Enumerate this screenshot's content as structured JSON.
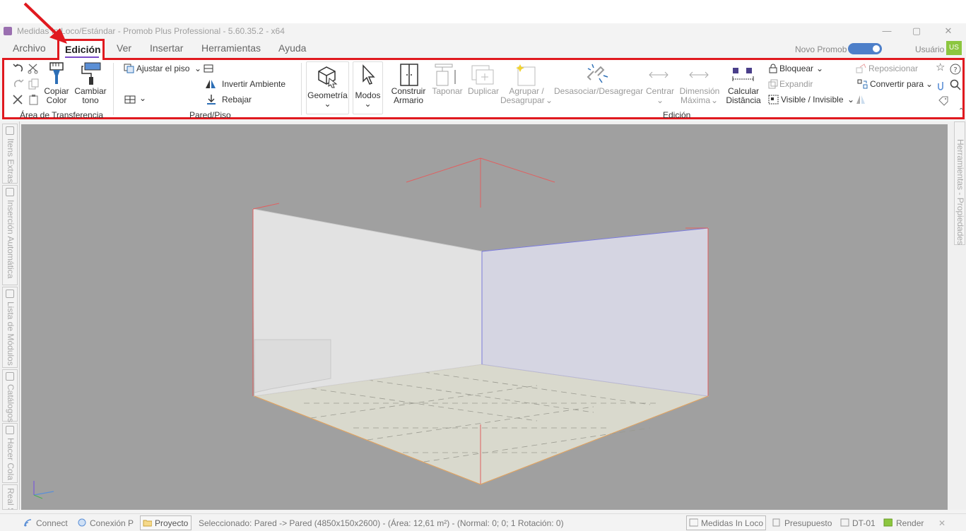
{
  "window": {
    "title": "Medidas In Loco/Estándar - Promob Plus Professional - 5.60.35.2 - x64",
    "minimize": "—",
    "maximize": "▢",
    "close": "✕"
  },
  "menu": {
    "archivo": "Archivo",
    "edicion": "Edición",
    "ver": "Ver",
    "insertar": "Insertar",
    "herramientas": "Herramientas",
    "ayuda": "Ayuda",
    "novo_promob": "Novo Promob",
    "usuario": "Usuário",
    "user_initials": "US"
  },
  "ribbon": {
    "transfer": {
      "copiar_color": [
        "Copiar",
        "Color"
      ],
      "cambiar_tono": [
        "Cambiar",
        "tono"
      ],
      "group_label": "Área de Transferencia"
    },
    "pared": {
      "ajustar_piso": "Ajustar el piso",
      "invertir_ambiente": "Invertir Ambiente",
      "rebajar": "Rebajar",
      "group_label": "Pared/Piso"
    },
    "geometria": "Geometría",
    "modos": "Modos",
    "edicion": {
      "construir_armario": [
        "Construir",
        "Armario"
      ],
      "taponar": "Taponar",
      "duplicar": "Duplicar",
      "agrupar": [
        "Agrupar /",
        "Desagrupar"
      ],
      "desasociar": "Desasociar/Desagregar",
      "centrar": "Centrar",
      "dimension_maxima": [
        "Dimensión",
        "Máxima"
      ],
      "calcular_distancia": [
        "Calcular",
        "Distância"
      ],
      "bloquear": "Bloquear",
      "expandir": "Expandir",
      "visible_invisible": "Visible / Invisible",
      "reposicionar": "Reposicionar",
      "convertir_para": "Convertir para",
      "group_label": "Edición"
    }
  },
  "side_panels": {
    "items_extras": "Itens Extras",
    "insercion_automatica": "Inserción Automática",
    "lista_modulos": "Lista de Módulos",
    "catalogos": "Catálogos",
    "hacer_cola": "Hacer Cola",
    "real_scene": "Real Scene",
    "herramientas_propiedades": "Herramientas - Propiedades"
  },
  "status": {
    "connect": "Connect",
    "conexion": "Conexión P",
    "proyecto": "Proyecto",
    "selection": "Seleccionado: Pared -> Pared (4850x150x2600) - (Área: 12,61 m²) - (Normal: 0; 0; 1 Rotación: 0)",
    "medidas": "Medidas In Loco",
    "presupuesto": "Presupuesto",
    "dt01": "DT-01",
    "render": "Render",
    "close": "✕"
  },
  "colors": {
    "highlight": "#e0191f",
    "toggle": "#4d7fc9",
    "avatar": "#8cc63f",
    "viewport_bg": "#a0a0a0",
    "menu_underline": "#7a4bc9"
  }
}
